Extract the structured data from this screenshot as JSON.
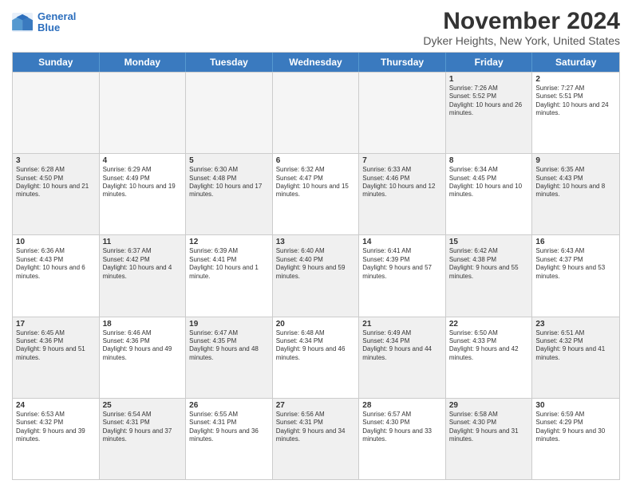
{
  "header": {
    "logo_line1": "General",
    "logo_line2": "Blue",
    "title": "November 2024",
    "subtitle": "Dyker Heights, New York, United States"
  },
  "days_of_week": [
    "Sunday",
    "Monday",
    "Tuesday",
    "Wednesday",
    "Thursday",
    "Friday",
    "Saturday"
  ],
  "rows": [
    [
      {
        "day": "",
        "info": "",
        "empty": true
      },
      {
        "day": "",
        "info": "",
        "empty": true
      },
      {
        "day": "",
        "info": "",
        "empty": true
      },
      {
        "day": "",
        "info": "",
        "empty": true
      },
      {
        "day": "",
        "info": "",
        "empty": true
      },
      {
        "day": "1",
        "info": "Sunrise: 7:26 AM\nSunset: 5:52 PM\nDaylight: 10 hours and 26 minutes.",
        "shaded": true
      },
      {
        "day": "2",
        "info": "Sunrise: 7:27 AM\nSunset: 5:51 PM\nDaylight: 10 hours and 24 minutes.",
        "shaded": false
      }
    ],
    [
      {
        "day": "3",
        "info": "Sunrise: 6:28 AM\nSunset: 4:50 PM\nDaylight: 10 hours and 21 minutes.",
        "shaded": true
      },
      {
        "day": "4",
        "info": "Sunrise: 6:29 AM\nSunset: 4:49 PM\nDaylight: 10 hours and 19 minutes.",
        "shaded": false
      },
      {
        "day": "5",
        "info": "Sunrise: 6:30 AM\nSunset: 4:48 PM\nDaylight: 10 hours and 17 minutes.",
        "shaded": true
      },
      {
        "day": "6",
        "info": "Sunrise: 6:32 AM\nSunset: 4:47 PM\nDaylight: 10 hours and 15 minutes.",
        "shaded": false
      },
      {
        "day": "7",
        "info": "Sunrise: 6:33 AM\nSunset: 4:46 PM\nDaylight: 10 hours and 12 minutes.",
        "shaded": true
      },
      {
        "day": "8",
        "info": "Sunrise: 6:34 AM\nSunset: 4:45 PM\nDaylight: 10 hours and 10 minutes.",
        "shaded": false
      },
      {
        "day": "9",
        "info": "Sunrise: 6:35 AM\nSunset: 4:43 PM\nDaylight: 10 hours and 8 minutes.",
        "shaded": true
      }
    ],
    [
      {
        "day": "10",
        "info": "Sunrise: 6:36 AM\nSunset: 4:43 PM\nDaylight: 10 hours and 6 minutes.",
        "shaded": false
      },
      {
        "day": "11",
        "info": "Sunrise: 6:37 AM\nSunset: 4:42 PM\nDaylight: 10 hours and 4 minutes.",
        "shaded": true
      },
      {
        "day": "12",
        "info": "Sunrise: 6:39 AM\nSunset: 4:41 PM\nDaylight: 10 hours and 1 minute.",
        "shaded": false
      },
      {
        "day": "13",
        "info": "Sunrise: 6:40 AM\nSunset: 4:40 PM\nDaylight: 9 hours and 59 minutes.",
        "shaded": true
      },
      {
        "day": "14",
        "info": "Sunrise: 6:41 AM\nSunset: 4:39 PM\nDaylight: 9 hours and 57 minutes.",
        "shaded": false
      },
      {
        "day": "15",
        "info": "Sunrise: 6:42 AM\nSunset: 4:38 PM\nDaylight: 9 hours and 55 minutes.",
        "shaded": true
      },
      {
        "day": "16",
        "info": "Sunrise: 6:43 AM\nSunset: 4:37 PM\nDaylight: 9 hours and 53 minutes.",
        "shaded": false
      }
    ],
    [
      {
        "day": "17",
        "info": "Sunrise: 6:45 AM\nSunset: 4:36 PM\nDaylight: 9 hours and 51 minutes.",
        "shaded": true
      },
      {
        "day": "18",
        "info": "Sunrise: 6:46 AM\nSunset: 4:36 PM\nDaylight: 9 hours and 49 minutes.",
        "shaded": false
      },
      {
        "day": "19",
        "info": "Sunrise: 6:47 AM\nSunset: 4:35 PM\nDaylight: 9 hours and 48 minutes.",
        "shaded": true
      },
      {
        "day": "20",
        "info": "Sunrise: 6:48 AM\nSunset: 4:34 PM\nDaylight: 9 hours and 46 minutes.",
        "shaded": false
      },
      {
        "day": "21",
        "info": "Sunrise: 6:49 AM\nSunset: 4:34 PM\nDaylight: 9 hours and 44 minutes.",
        "shaded": true
      },
      {
        "day": "22",
        "info": "Sunrise: 6:50 AM\nSunset: 4:33 PM\nDaylight: 9 hours and 42 minutes.",
        "shaded": false
      },
      {
        "day": "23",
        "info": "Sunrise: 6:51 AM\nSunset: 4:32 PM\nDaylight: 9 hours and 41 minutes.",
        "shaded": true
      }
    ],
    [
      {
        "day": "24",
        "info": "Sunrise: 6:53 AM\nSunset: 4:32 PM\nDaylight: 9 hours and 39 minutes.",
        "shaded": false
      },
      {
        "day": "25",
        "info": "Sunrise: 6:54 AM\nSunset: 4:31 PM\nDaylight: 9 hours and 37 minutes.",
        "shaded": true
      },
      {
        "day": "26",
        "info": "Sunrise: 6:55 AM\nSunset: 4:31 PM\nDaylight: 9 hours and 36 minutes.",
        "shaded": false
      },
      {
        "day": "27",
        "info": "Sunrise: 6:56 AM\nSunset: 4:31 PM\nDaylight: 9 hours and 34 minutes.",
        "shaded": true
      },
      {
        "day": "28",
        "info": "Sunrise: 6:57 AM\nSunset: 4:30 PM\nDaylight: 9 hours and 33 minutes.",
        "shaded": false
      },
      {
        "day": "29",
        "info": "Sunrise: 6:58 AM\nSunset: 4:30 PM\nDaylight: 9 hours and 31 minutes.",
        "shaded": true
      },
      {
        "day": "30",
        "info": "Sunrise: 6:59 AM\nSunset: 4:29 PM\nDaylight: 9 hours and 30 minutes.",
        "shaded": false
      }
    ]
  ]
}
